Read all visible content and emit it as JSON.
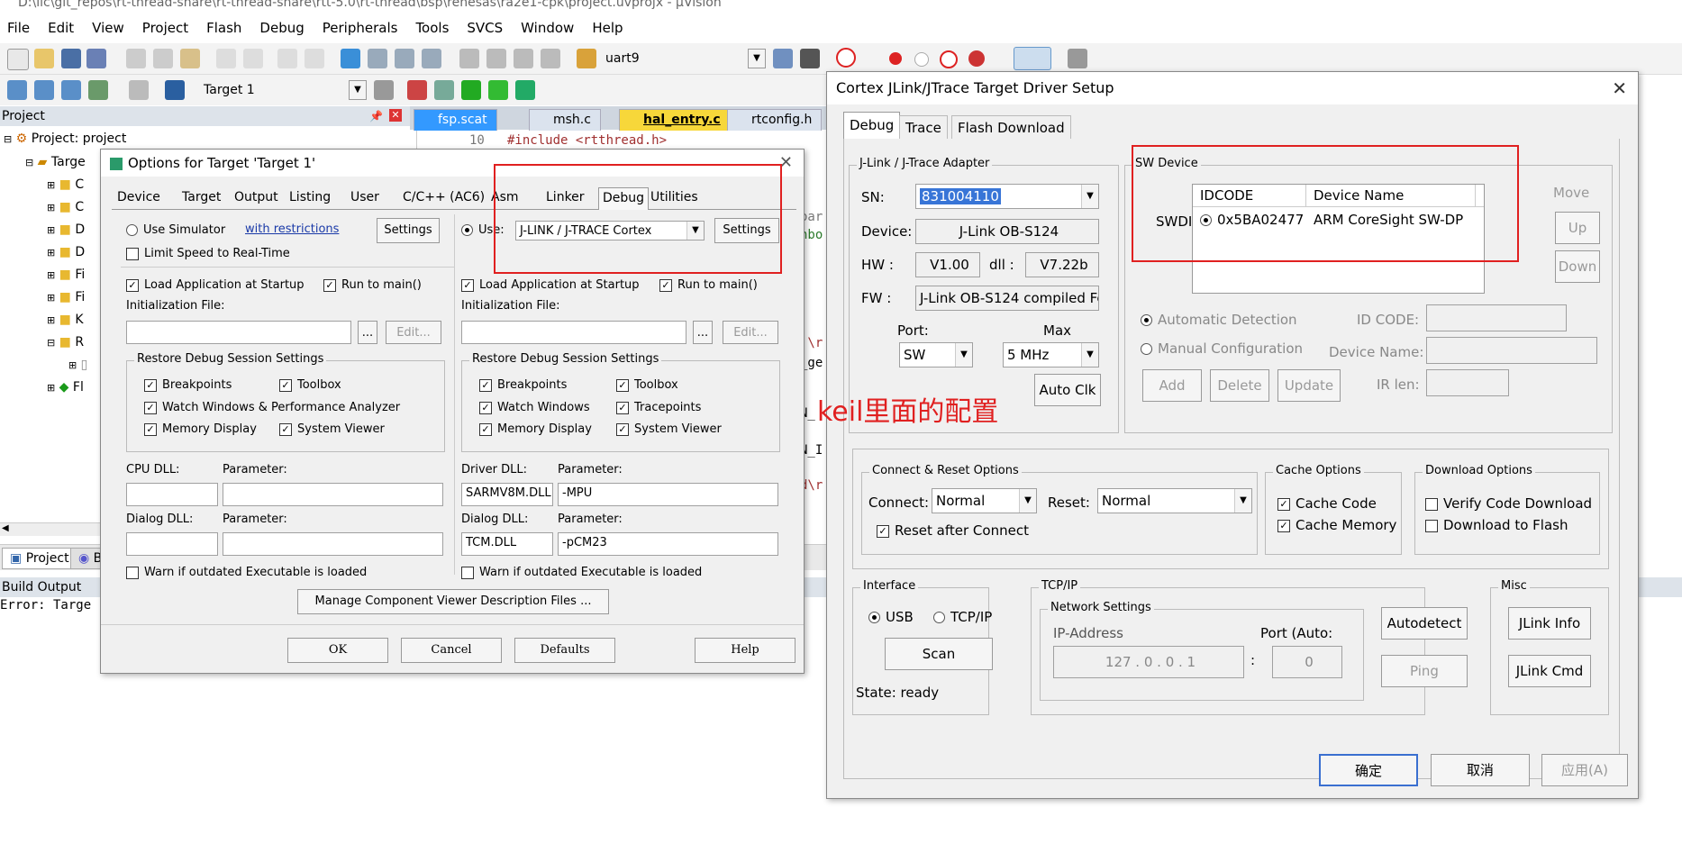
{
  "window_title": "D:\\llc\\git_repos\\rt-thread-share\\rt-thread-share\\rtt-5.0\\rt-thread\\bsp\\renesas\\ra2e1-cpk\\project.uvprojx - µVision",
  "menu": [
    "File",
    "Edit",
    "View",
    "Project",
    "Flash",
    "Debug",
    "Peripherals",
    "Tools",
    "SVCS",
    "Window",
    "Help"
  ],
  "toolbar": {
    "search_combo": "uart9",
    "target_combo": "Target 1"
  },
  "project_panel": {
    "title": "Project",
    "root": "Project: project",
    "target_item": "Targe",
    "items": [
      "C",
      "C",
      "D",
      "D",
      "Fi",
      "Fi",
      "K",
      "R",
      "",
      "Fl"
    ],
    "tab_project": "Project",
    "tab_books": "B"
  },
  "editor_tabs": [
    "fsp.scat",
    "msh.c",
    "hal_entry.c",
    "rtconfig.h"
  ],
  "editor": {
    "line_no": "10",
    "line_text": "#include <rtthread.h>",
    "frag1": "oar",
    "frag2": "nbo",
    "frag3": "!\\r",
    "frag4": "_ge",
    "frag5": "N_",
    "frag6": "N_I",
    "frag7": "d\\r"
  },
  "build_output": {
    "title": "Build Output",
    "text": "Error: Targe"
  },
  "options_dialog": {
    "title": "Options for Target 'Target 1'",
    "tabs": [
      "Device",
      "Target",
      "Output",
      "Listing",
      "User",
      "C/C++ (AC6)",
      "Asm",
      "Linker",
      "Debug",
      "Utilities"
    ],
    "left": {
      "use_simulator": "Use Simulator",
      "restrictions_link": "with restrictions",
      "settings": "Settings",
      "limit_speed": "Limit Speed to Real-Time",
      "load_app": "Load Application at Startup",
      "run_main": "Run to main()",
      "init_file": "Initialization File:",
      "browse": "...",
      "edit": "Edit...",
      "restore_title": "Restore Debug Session Settings",
      "breakpoints": "Breakpoints",
      "toolbox": "Toolbox",
      "watch": "Watch Windows & Performance Analyzer",
      "memory": "Memory Display",
      "sysviewer": "System Viewer",
      "dll_label": "CPU DLL:",
      "param_label": "Parameter:",
      "dll_value": "",
      "param_value": "",
      "dialog_dll_label": "Dialog DLL:",
      "dialog_dll_value": "",
      "dialog_param_value": "",
      "warn": "Warn if outdated Executable is loaded"
    },
    "right": {
      "use": "Use:",
      "driver": "J-LINK / J-TRACE Cortex",
      "settings": "Settings",
      "load_app": "Load Application at Startup",
      "run_main": "Run to main()",
      "init_file": "Initialization File:",
      "browse": "...",
      "edit": "Edit...",
      "restore_title": "Restore Debug Session Settings",
      "breakpoints": "Breakpoints",
      "toolbox": "Toolbox",
      "watch": "Watch Windows",
      "tracepoints": "Tracepoints",
      "memory": "Memory Display",
      "sysviewer": "System Viewer",
      "dll_label": "Driver DLL:",
      "param_label": "Parameter:",
      "dll_value": "SARMV8M.DLL",
      "param_value": "-MPU",
      "dialog_dll_label": "Dialog DLL:",
      "dialog_dll_value": "TCM.DLL",
      "dialog_param_value": "-pCM23",
      "warn": "Warn if outdated Executable is loaded"
    },
    "manage_btn": "Manage Component Viewer Description Files ...",
    "ok": "OK",
    "cancel": "Cancel",
    "defaults": "Defaults",
    "help": "Help"
  },
  "jlink_dialog": {
    "title": "Cortex JLink/JTrace Target Driver Setup",
    "tabs": [
      "Debug",
      "Trace",
      "Flash Download"
    ],
    "adapter": {
      "title": "J-Link / J-Trace Adapter",
      "sn_label": "SN:",
      "sn_value": "831004110",
      "device_label": "Device:",
      "device_value": "J-Link OB-S124",
      "hw_label": "HW :",
      "hw_value": "V1.00",
      "dll_label": "dll :",
      "dll_value": "V7.22b",
      "fw_label": "FW :",
      "fw_value": "J-Link OB-S124 compiled Fe",
      "port_label": "Port:",
      "port_value": "SW",
      "max_label": "Max",
      "max_value": "5 MHz",
      "auto_clk": "Auto Clk"
    },
    "sw_device": {
      "title": "SW Device",
      "col_idcode": "IDCODE",
      "col_name": "Device Name",
      "row_label": "SWDI",
      "row_idcode": "0x5BA02477",
      "row_name": "ARM CoreSight SW-DP",
      "move": "Move",
      "up": "Up",
      "down": "Down",
      "auto_detect": "Automatic Detection",
      "manual_config": "Manual Configuration",
      "id_code_label": "ID CODE:",
      "device_name_label": "Device Name:",
      "ir_len_label": "IR len:",
      "add": "Add",
      "delete": "Delete",
      "update": "Update"
    },
    "annotation": "keil里面的配置",
    "connect_reset": {
      "title": "Connect & Reset Options",
      "connect_label": "Connect:",
      "connect_value": "Normal",
      "reset_label": "Reset:",
      "reset_value": "Normal",
      "reset_after": "Reset after Connect"
    },
    "cache": {
      "title": "Cache Options",
      "code": "Cache Code",
      "memory": "Cache Memory"
    },
    "download": {
      "title": "Download Options",
      "verify": "Verify Code Download",
      "to_flash": "Download to Flash"
    },
    "interface": {
      "title": "Interface",
      "usb": "USB",
      "tcpip": "TCP/IP",
      "scan": "Scan",
      "state": "State: ready"
    },
    "tcpip": {
      "title": "TCP/IP",
      "net_title": "Network Settings",
      "ip_label": "IP-Address",
      "port_label": "Port (Auto:",
      "ip_value": "127 .  0  .  0  .  1",
      "port_value": "0",
      "autodetect": "Autodetect",
      "ping": "Ping"
    },
    "misc": {
      "title": "Misc",
      "info": "JLink Info",
      "cmd": "JLink Cmd"
    },
    "ok": "确定",
    "cancel": "取消",
    "apply": "应用(A)"
  },
  "colors": {
    "annotation_red": "#e02020",
    "selection_blue": "#3875d7",
    "dialog_bg": "#f0f0f0"
  }
}
